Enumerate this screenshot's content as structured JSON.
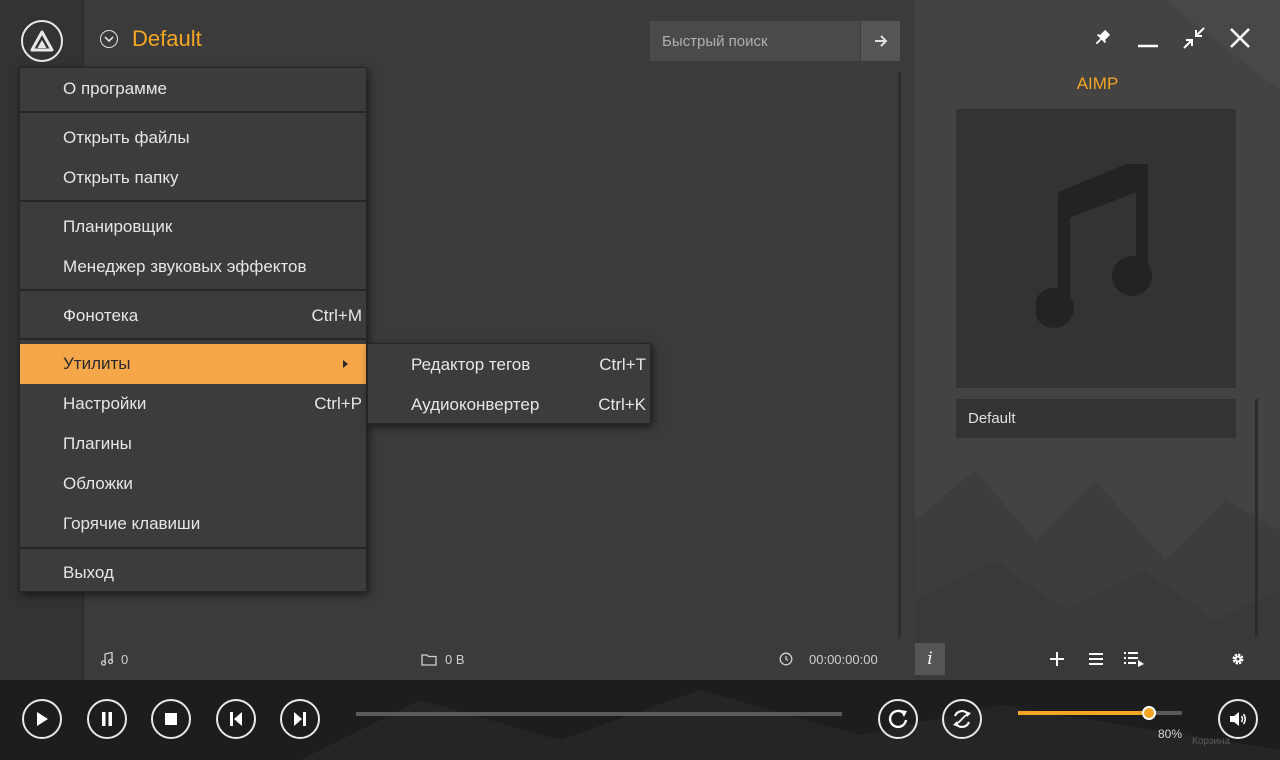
{
  "app": {
    "title": "AIMP"
  },
  "playlist": {
    "title": "Default",
    "search_placeholder": "Быстрый поиск",
    "status": {
      "tracks": "0",
      "size": "0 B",
      "duration": "00:00:00:00"
    }
  },
  "player": {
    "track_title": "Default",
    "volume_label": "80%",
    "volume_fraction": 0.8,
    "trash_label": "Корзина"
  },
  "main_menu": {
    "items": [
      {
        "label": "О программе",
        "shortcut": ""
      },
      {
        "label": "Открыть файлы",
        "shortcut": ""
      },
      {
        "label": "Открыть папку",
        "shortcut": ""
      },
      {
        "label": "Планировщик",
        "shortcut": ""
      },
      {
        "label": "Менеджер звуковых эффектов",
        "shortcut": ""
      },
      {
        "label": "Фонотека",
        "shortcut": "Ctrl+M"
      },
      {
        "label": "Утилиты",
        "shortcut": ""
      },
      {
        "label": "Настройки",
        "shortcut": "Ctrl+P"
      },
      {
        "label": "Плагины",
        "shortcut": ""
      },
      {
        "label": "Обложки",
        "shortcut": ""
      },
      {
        "label": "Горячие клавиши",
        "shortcut": ""
      },
      {
        "label": "Выход",
        "shortcut": ""
      }
    ]
  },
  "submenu": {
    "items": [
      {
        "label": "Редактор тегов",
        "shortcut": "Ctrl+T"
      },
      {
        "label": "Аудиоконвертер",
        "shortcut": "Ctrl+K"
      }
    ]
  },
  "icons": {
    "logo": "aimp-logo-icon",
    "search_go": "arrow-right-icon",
    "pin": "pin-icon",
    "minimize": "minimize-icon",
    "compact": "compact-mode-icon",
    "close": "close-icon",
    "album": "music-note-icon"
  },
  "colors": {
    "accent": "#f5a623",
    "menu_highlight": "#f5a74a",
    "background": "#3b3b3b",
    "bottom_bar": "#1d1d1d"
  }
}
